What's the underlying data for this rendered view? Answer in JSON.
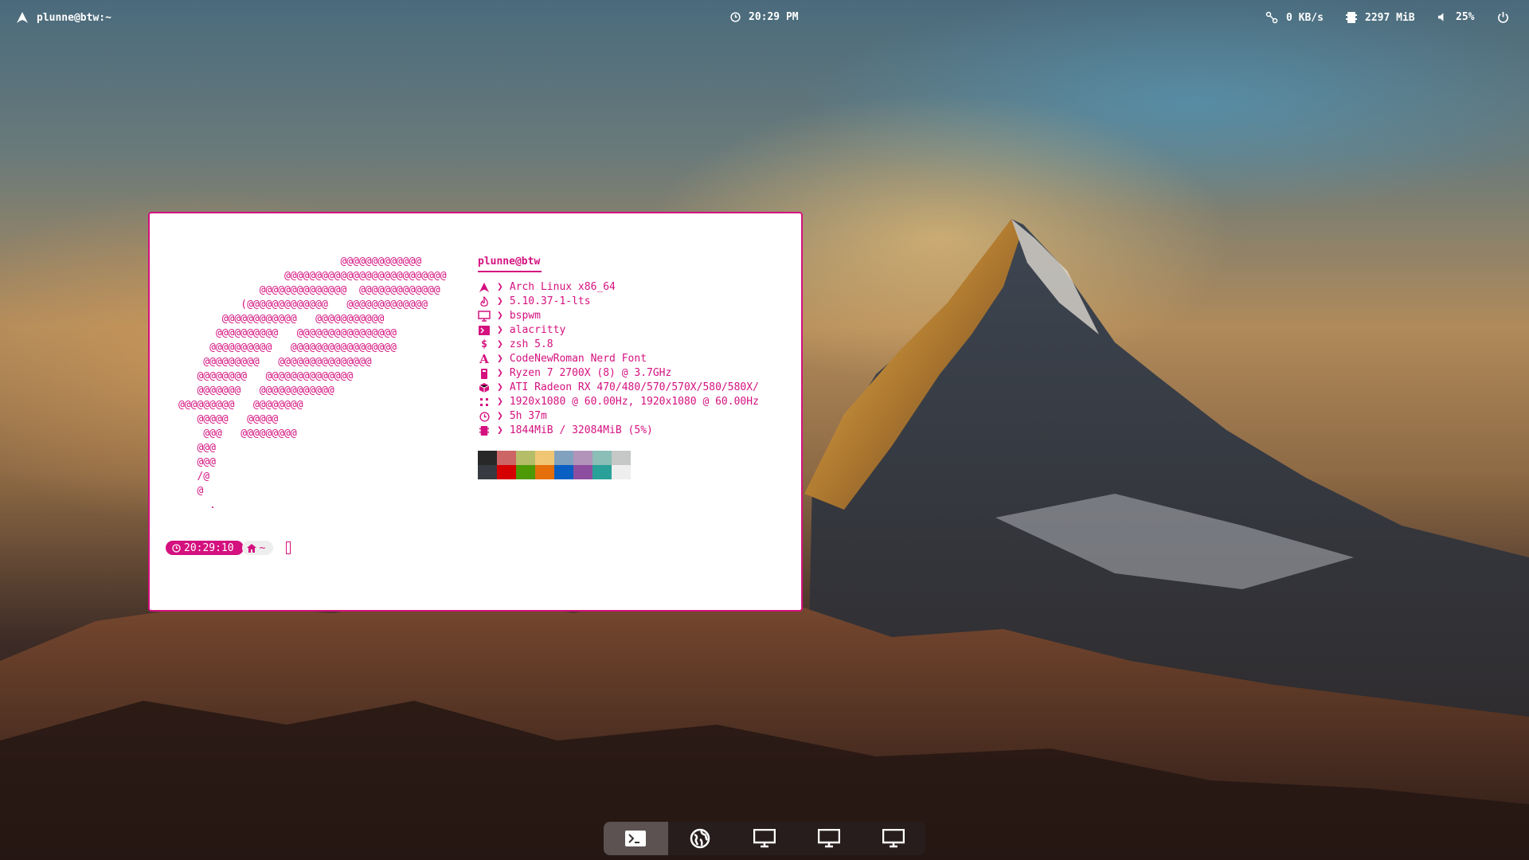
{
  "topbar": {
    "left": {
      "icon": "arch-icon",
      "title": "plunne@btw:~"
    },
    "center": {
      "icon": "clock-icon",
      "time": "20:29 PM"
    },
    "right": {
      "network": {
        "icon": "network-icon",
        "value": "0 KB/s"
      },
      "memory": {
        "icon": "memory-icon",
        "value": "2297 MiB"
      },
      "volume": {
        "icon": "volume-icon",
        "value": "25%"
      },
      "power": {
        "icon": "power-icon"
      }
    }
  },
  "terminal": {
    "accent_color": "#d4117f",
    "ascii_art": "                          @@@@@@@@@@@@@\n                 @@@@@@@@@@@@@@@@@@@@@@@@@@\n             @@@@@@@@@@@@@@  @@@@@@@@@@@@@\n          (@@@@@@@@@@@@@   @@@@@@@@@@@@@\n       @@@@@@@@@@@@   @@@@@@@@@@@\n      @@@@@@@@@@   @@@@@@@@@@@@@@@@\n     @@@@@@@@@@   @@@@@@@@@@@@@@@@@\n    @@@@@@@@@   @@@@@@@@@@@@@@@\n   @@@@@@@@   @@@@@@@@@@@@@@\n   @@@@@@@   @@@@@@@@@@@@\n@@@@@@@@@   @@@@@@@@\n   @@@@@   @@@@@\n    @@@   @@@@@@@@@\n   @@@\n   @@@\n   /@\n   @\n     .",
    "info": {
      "user": "plunne@btw",
      "rows": [
        {
          "icon": "arch-icon",
          "value": "Arch Linux x86_64"
        },
        {
          "icon": "kernel-flame-icon",
          "value": "5.10.37-1-lts"
        },
        {
          "icon": "monitor-icon",
          "value": "bspwm"
        },
        {
          "icon": "terminal-icon",
          "value": "alacritty"
        },
        {
          "icon": "dollar-icon",
          "value": "zsh 5.8"
        },
        {
          "icon": "font-icon",
          "value": "CodeNewRoman Nerd Font"
        },
        {
          "icon": "cpu-icon",
          "value": "Ryzen 7 2700X (8) @ 3.7GHz"
        },
        {
          "icon": "gpu-cube-icon",
          "value": "ATI Radeon RX 470/480/570/570X/580/580X/"
        },
        {
          "icon": "resolution-icon",
          "value": "1920x1080 @ 60.00Hz, 1920x1080 @ 60.00Hz"
        },
        {
          "icon": "clock-icon",
          "value": "5h 37m"
        },
        {
          "icon": "memory-icon",
          "value": "1844MiB / 32084MiB (5%)"
        }
      ],
      "palette": {
        "top": [
          "#282828",
          "#cc6666",
          "#b5bd68",
          "#f0c674",
          "#81a2be",
          "#b294bb",
          "#8abeb7",
          "#c5c8c6"
        ],
        "bottom": [
          "#373b41",
          "#d70000",
          "#4e9a06",
          "#e56f0b",
          "#0a60c2",
          "#8e4ea0",
          "#2aa198",
          "#eeeeee"
        ]
      }
    },
    "prompt": {
      "time": "20:29:10",
      "dir": "~"
    }
  },
  "dock": {
    "workspaces": [
      {
        "icon": "terminal-icon",
        "active": true
      },
      {
        "icon": "globe-icon",
        "active": false
      },
      {
        "icon": "monitor-icon",
        "active": false
      },
      {
        "icon": "monitor-icon",
        "active": false
      },
      {
        "icon": "monitor-icon",
        "active": false
      }
    ]
  }
}
